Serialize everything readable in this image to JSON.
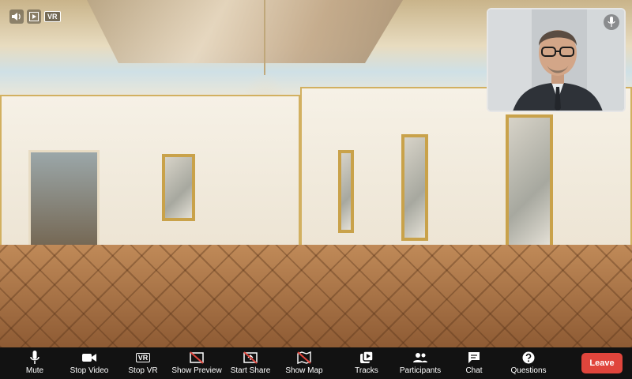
{
  "top_controls": {
    "vr_badge": "VR"
  },
  "toolbar": {
    "items": [
      {
        "label": "Mute",
        "icon": "mic-icon"
      },
      {
        "label": "Stop Video",
        "icon": "video-camera-icon"
      },
      {
        "label": "Stop VR",
        "icon": "vr-icon"
      },
      {
        "label": "Show Preview",
        "icon": "preview-off-icon"
      },
      {
        "label": "Start Share",
        "icon": "share-off-icon"
      },
      {
        "label": "Show Map",
        "icon": "map-off-icon"
      },
      {
        "label": "Tracks",
        "icon": "tracks-icon"
      },
      {
        "label": "Participants",
        "icon": "participants-icon"
      },
      {
        "label": "Chat",
        "icon": "chat-icon"
      },
      {
        "label": "Questions",
        "icon": "question-icon"
      }
    ],
    "stop_vr_icon_text": "VR",
    "leave_label": "Leave"
  },
  "colors": {
    "toolbar_bg": "#121212",
    "leave": "#e0453c",
    "disabled_slash": "#e0453c"
  }
}
